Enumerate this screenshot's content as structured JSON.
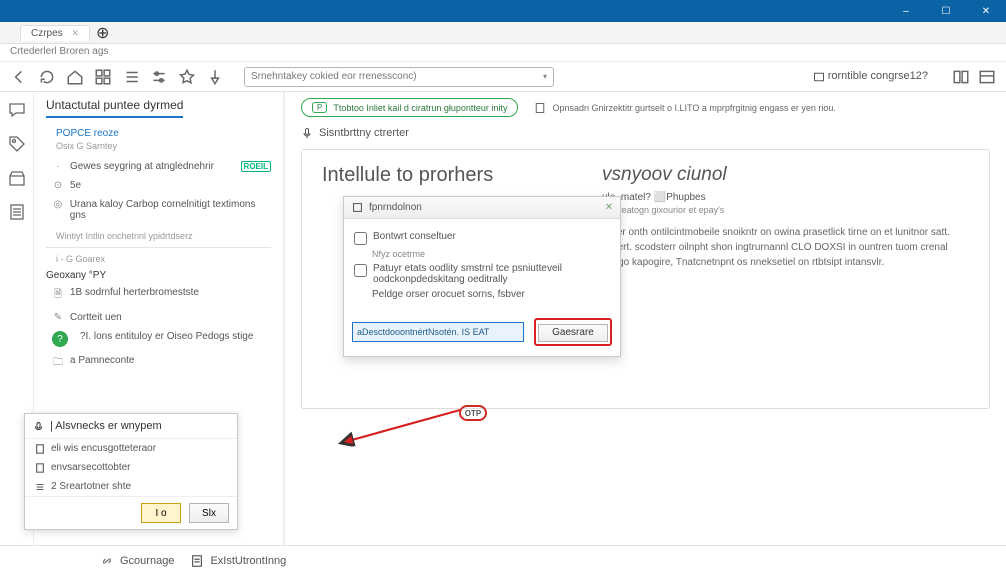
{
  "window": {
    "min": "–",
    "max": "☐",
    "close": "✕"
  },
  "tabs": [
    {
      "label": "Czrpes",
      "closable": true
    }
  ],
  "crumb": "Crtederlerl Broren ags",
  "toolbar": {
    "search_text": "Srnehntakey cokied eor rrenessconc)"
  },
  "right_label": "rorntible congrse12?",
  "sidebar": {
    "heading": "Untactutal puntee dyrmed",
    "section1": "POPCE reoze",
    "section1_sub": "Osix G Sarntey",
    "items": [
      {
        "icon": "·",
        "label": "Gewes seygring at atnglednehrir",
        "badge": "ROEIL"
      },
      {
        "icon": "⊙",
        "label": "5e"
      },
      {
        "icon": "◎",
        "label": "Urana kaloy Carbop cornelnitigt textimons gns"
      }
    ],
    "caption": "Wintiyt Intlin onchetnnl ypidrtdserz",
    "group1": "i - G Goarex",
    "group1b": "Geoxany °PY",
    "g1_items": [
      {
        "icon": "🗎",
        "label": "1B sodrnful herterbromestste"
      },
      {
        "icon": "✎",
        "label": "Cortteit uen"
      },
      {
        "icon": "?",
        "label": "?I. lons entituloy er Oiseo Pedogs stige",
        "green": true
      },
      {
        "icon": "🗀",
        "label": "a Pamneconte"
      }
    ]
  },
  "banner": {
    "chip": "P",
    "pill_text": "Ttobtoo Inliet kail d ciratrun głupontteur inity",
    "right_text": "Opnsadn Gnirzektitr gurtselt o I.LITO a mprpfrgitnig engass er yen riou."
  },
  "subrow": "Sisntbrttny ctrerter",
  "content": {
    "left_title": "Intellule to prorhers",
    "right_title": "vsnyoov ciunol",
    "meta1": "ule. matel? ⬜Phupbes",
    "meta2": "Legyeatogn gixourior et epay's",
    "para": "Woer onth ontilcintmobeile snoikntr on owina prasetlick tirne on et lunitnor satt. satiert. scodsterr oilnpht shon ingtrurnannl CLO DOXSI in ountren tuom crenal mingo kapogire, Tnatcnetnpnt os nneksetiel on rtbtsipt intansvlr."
  },
  "dialog": {
    "title": "fpnrndolnon",
    "row1": "Bontwrt conseltuer",
    "row1_sub": "Nfyz ocetrme",
    "row2": "Patuyr etats oodlity smstrnl tce psniutteveil oodckonpdedskitang oeditrally",
    "row3": "Peldge orser orocuet sorns, fsbver",
    "input_value": "aDesctdooontnértNsotén. IS EAT",
    "button": "Gaesrare"
  },
  "circled": "OTP",
  "popup": {
    "title": "| Alsvnecks er wnypem",
    "items": [
      {
        "label": "eli wis encusgotteteraor"
      },
      {
        "label": "envsarsecottobter"
      },
      {
        "label": "2 Sreartotner shte"
      }
    ],
    "ok": "I o",
    "cancel": "Slx"
  },
  "status": {
    "left": "Gcournage",
    "right": "ExIstUtrontInng"
  }
}
